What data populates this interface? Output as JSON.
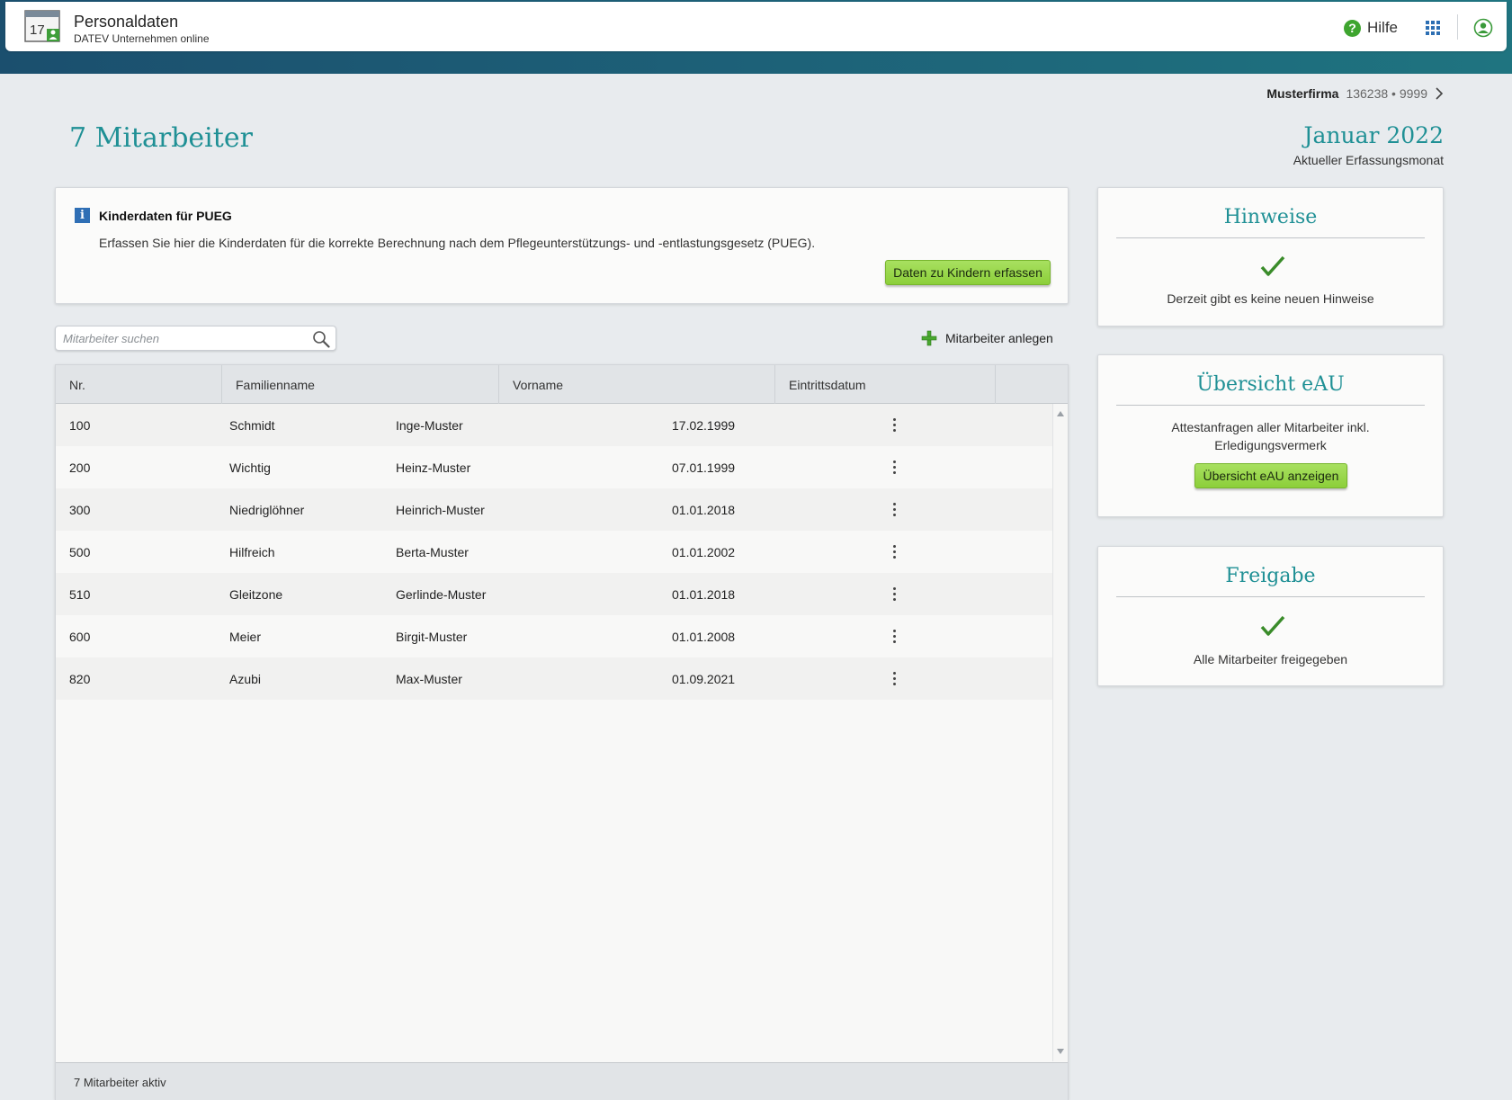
{
  "header": {
    "app_title": "Personaldaten",
    "app_subtitle": "DATEV Unternehmen online",
    "icon_day": "17",
    "help_label": "Hilfe"
  },
  "company": {
    "name": "Musterfirma",
    "number": "136238 • 9999"
  },
  "page_title": "7 Mitarbeiter",
  "period": {
    "month": "Januar 2022",
    "label": "Aktueller Erfassungsmonat"
  },
  "info_card": {
    "title": "Kinderdaten für PUEG",
    "text": "Erfassen Sie hier die Kinderdaten für die korrekte Berechnung nach dem Pflegeunterstützungs- und -entlastungsgesetz (PUEG).",
    "button_label": "Daten zu Kindern erfassen"
  },
  "search": {
    "placeholder": "Mitarbeiter suchen",
    "value": ""
  },
  "add_employee_label": "Mitarbeiter anlegen",
  "table": {
    "columns": [
      "Nr.",
      "Familienname",
      "Vorname",
      "Eintrittsdatum"
    ],
    "rows": [
      {
        "nr": "100",
        "familienname": "Schmidt",
        "vorname": "Inge-Muster",
        "eintritt": "17.02.1999"
      },
      {
        "nr": "200",
        "familienname": "Wichtig",
        "vorname": "Heinz-Muster",
        "eintritt": "07.01.1999"
      },
      {
        "nr": "300",
        "familienname": "Niedriglöhner",
        "vorname": "Heinrich-Muster",
        "eintritt": "01.01.2018"
      },
      {
        "nr": "500",
        "familienname": "Hilfreich",
        "vorname": "Berta-Muster",
        "eintritt": "01.01.2002"
      },
      {
        "nr": "510",
        "familienname": "Gleitzone",
        "vorname": "Gerlinde-Muster",
        "eintritt": "01.01.2018"
      },
      {
        "nr": "600",
        "familienname": "Meier",
        "vorname": "Birgit-Muster",
        "eintritt": "01.01.2008"
      },
      {
        "nr": "820",
        "familienname": "Azubi",
        "vorname": "Max-Muster",
        "eintritt": "01.09.2021"
      }
    ],
    "footer": "7 Mitarbeiter aktiv"
  },
  "side_cards": {
    "hinweise": {
      "title": "Hinweise",
      "text": "Derzeit gibt es keine neuen Hinweise"
    },
    "eau": {
      "title": "Übersicht eAU",
      "text": "Attestanfragen aller Mitarbeiter inkl. Erledigungsvermerk",
      "button_label": "Übersicht eAU anzeigen"
    },
    "freigabe": {
      "title": "Freigabe",
      "text": "Alle Mitarbeiter freigegeben"
    }
  },
  "icons": {
    "app": "calendar-person-icon",
    "help": "help-circle-icon",
    "apps": "apps-grid-icon",
    "user": "user-account-icon",
    "info": "info-icon",
    "search": "search-icon",
    "add": "plus-icon",
    "row_menu": "kebab-menu-icon",
    "check": "checkmark-icon"
  },
  "colors": {
    "accent_teal": "#1f9095",
    "button_green": "#8ccf3a",
    "header_band": "#1d6178",
    "info_blue": "#2f6fb5"
  }
}
